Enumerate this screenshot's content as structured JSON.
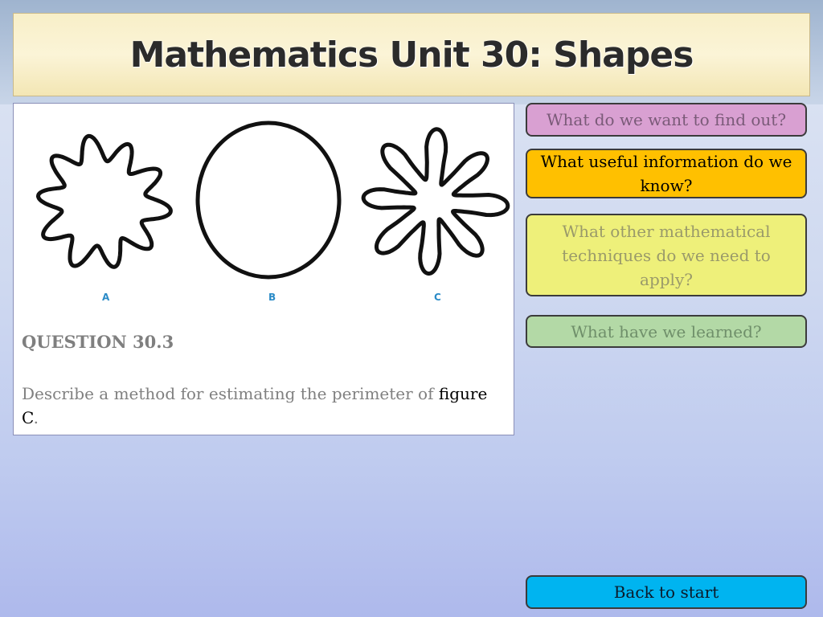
{
  "header": {
    "title": "Mathematics Unit 30: Shapes"
  },
  "figure": {
    "labels": [
      "A",
      "B",
      "C"
    ]
  },
  "question": {
    "title": "QUESTION 30.3",
    "text_prefix": "Describe a method for estimating the perimeter of ",
    "text_emphasis": "figure C",
    "text_suffix": "."
  },
  "nav": {
    "find_out": "What do we want to find out?",
    "useful_info": "What useful information do we know?",
    "techniques": "What other mathematical techniques do we need to apply?",
    "learned": "What have we learned?",
    "back": "Back to start"
  },
  "colors": {
    "find_out": "#d9a0d2",
    "useful_info": "#ffc000",
    "techniques": "#eef07a",
    "learned": "#b3d9a6",
    "back": "#00b4f0",
    "shape_label": "#2a8bc7"
  }
}
